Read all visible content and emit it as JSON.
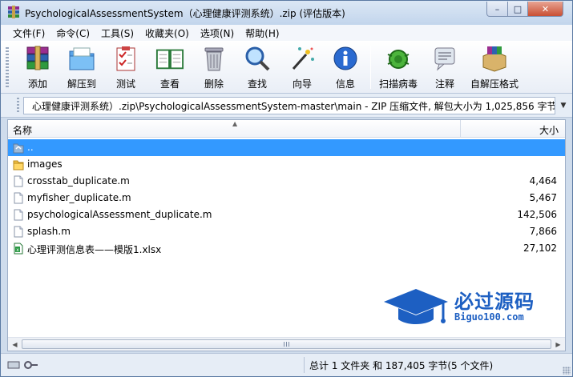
{
  "window": {
    "title": "PsychologicalAssessmentSystem（心理健康评测系统）.zip (评估版本)",
    "minimize": "–",
    "maximize": "□",
    "close": "✕"
  },
  "menu": [
    {
      "label": "文件(F)",
      "name": "menu-file"
    },
    {
      "label": "命令(C)",
      "name": "menu-command"
    },
    {
      "label": "工具(S)",
      "name": "menu-tools"
    },
    {
      "label": "收藏夹(O)",
      "name": "menu-favorites"
    },
    {
      "label": "选项(N)",
      "name": "menu-options"
    },
    {
      "label": "帮助(H)",
      "name": "menu-help"
    }
  ],
  "toolbar": {
    "add": "添加",
    "extract_to": "解压到",
    "test": "测试",
    "view": "查看",
    "delete": "删除",
    "find": "查找",
    "wizard": "向导",
    "info": "信息",
    "virus_scan": "扫描病毒",
    "comment": "注释",
    "sfx": "自解压格式"
  },
  "address": {
    "path": "心理健康评测系统）.zip\\PsychologicalAssessmentSystem-master\\main - ZIP 压缩文件, 解包大小为 1,025,856 字节"
  },
  "columns": {
    "name": "名称",
    "size": "大小"
  },
  "files": [
    {
      "name": "..",
      "size": "",
      "type": "parent",
      "selected": true
    },
    {
      "name": "images",
      "size": "",
      "type": "folder",
      "selected": false
    },
    {
      "name": "crosstab_duplicate.m",
      "size": "4,464",
      "type": "file",
      "selected": false
    },
    {
      "name": "myfisher_duplicate.m",
      "size": "5,467",
      "type": "file",
      "selected": false
    },
    {
      "name": "psychologicalAssessment_duplicate.m",
      "size": "142,506",
      "type": "file",
      "selected": false
    },
    {
      "name": "splash.m",
      "size": "7,866",
      "type": "file",
      "selected": false
    },
    {
      "name": "心理评测信息表——模版1.xlsx",
      "size": "27,102",
      "type": "excel",
      "selected": false
    }
  ],
  "watermark": {
    "title": "必过源码",
    "subtitle": "Biguo100.com"
  },
  "status": {
    "text": "总计 1 文件夹 和 187,405 字节(5 个文件)"
  },
  "colors": {
    "selection": "#3399ff",
    "chrome": "#cfdcec",
    "watermark": "#1d5fc2"
  }
}
